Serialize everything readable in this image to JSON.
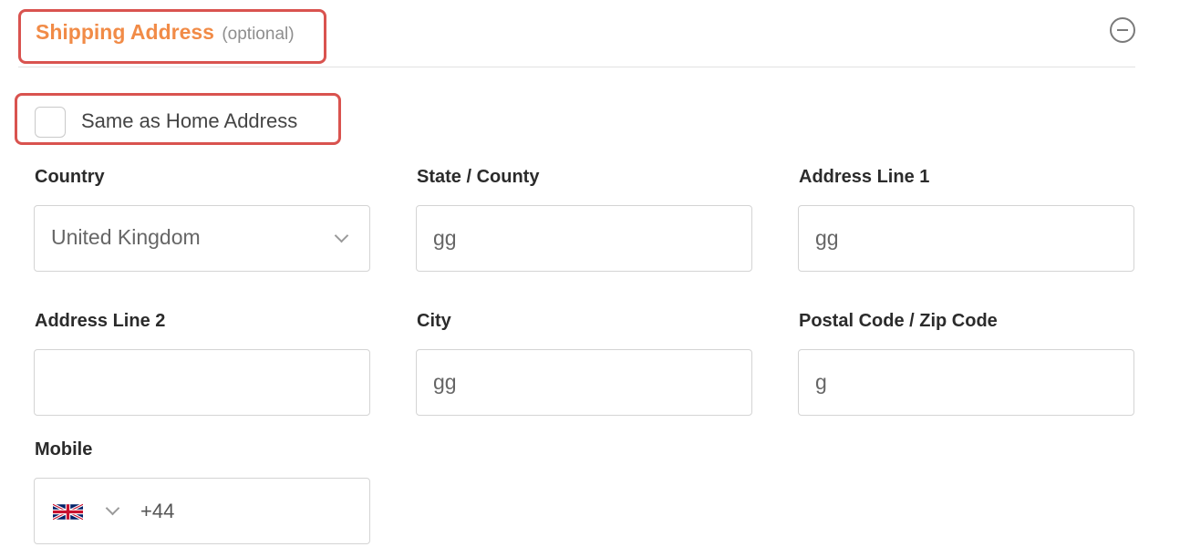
{
  "header": {
    "title": "Shipping Address",
    "optional": "(optional)",
    "collapse_icon": "minus-circle-icon"
  },
  "same_as_home": {
    "label": "Same as Home Address",
    "checked": false
  },
  "fields": {
    "country": {
      "label": "Country",
      "value": "United Kingdom"
    },
    "state": {
      "label": "State / County",
      "value": "gg"
    },
    "address1": {
      "label": "Address Line 1",
      "value": "gg"
    },
    "address2": {
      "label": "Address Line 2",
      "value": ""
    },
    "city": {
      "label": "City",
      "value": "gg"
    },
    "postal": {
      "label": "Postal Code / Zip Code",
      "value": "g"
    },
    "mobile": {
      "label": "Mobile",
      "flag_icon": "uk-flag-icon",
      "dial_code": "+44",
      "value": ""
    }
  },
  "colors": {
    "accent": "#f18b47",
    "highlight_border": "#d9534f"
  }
}
